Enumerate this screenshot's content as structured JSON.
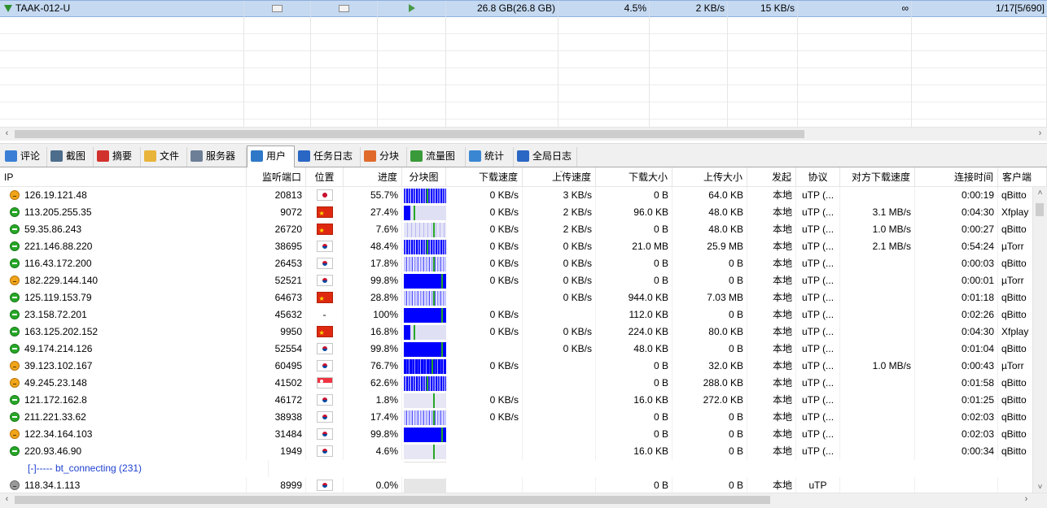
{
  "task": {
    "name": "TAAK-012-U",
    "size": "26.8 GB(26.8 GB)",
    "progress": "4.5%",
    "download_speed": "2 KB/s",
    "upload_speed": "15 KB/s",
    "remaining": "∞",
    "peers": "1/17[5/690]"
  },
  "tabs": [
    {
      "label": "评论",
      "icon": "comment-icon",
      "color": "#3a7fd5"
    },
    {
      "label": "截图",
      "icon": "screenshot-icon",
      "color": "#4d6d8c"
    },
    {
      "label": "摘要",
      "icon": "summary-icon",
      "color": "#d2322d"
    },
    {
      "label": "文件",
      "icon": "folder-icon",
      "color": "#e8b43a"
    },
    {
      "label": "服务器",
      "icon": "server-icon",
      "color": "#6d7f96"
    },
    {
      "label": "用户",
      "icon": "users-icon",
      "color": "#2f78c8"
    },
    {
      "label": "任务日志",
      "icon": "info-icon",
      "color": "#2a66c4"
    },
    {
      "label": "分块",
      "icon": "pie-icon",
      "color": "#e06a2a"
    },
    {
      "label": "流量图",
      "icon": "chart-icon",
      "color": "#3a9a3a"
    },
    {
      "label": "统计",
      "icon": "stats-icon",
      "color": "#3a86d2"
    },
    {
      "label": "全局日志",
      "icon": "info-icon",
      "color": "#2a66c4"
    }
  ],
  "active_tab": 5,
  "columns": [
    "IP",
    "监听端口",
    "位置",
    "进度",
    "分块图",
    "下载速度",
    "上传速度",
    "下载大小",
    "上传大小",
    "发起",
    "协议",
    "对方下载速度",
    "连接时间",
    "客户端"
  ],
  "peers": [
    {
      "status": "orange",
      "ip": "126.19.121.48",
      "port": "20813",
      "flag": "jp",
      "progress": 0.557,
      "progress_text": "55.7%",
      "blocks": "mid",
      "dl": "0 KB/s",
      "ul": "3 KB/s",
      "dl_size": "0 B",
      "ul_size": "64.0 KB",
      "origin": "本地",
      "protocol": "uTP (...",
      "peer_dl": "",
      "time": "0:00:19",
      "client": "qBitto"
    },
    {
      "status": "green",
      "ip": "113.205.255.35",
      "port": "9072",
      "flag": "cn",
      "progress": 0.274,
      "progress_text": "27.4%",
      "blocks": "low",
      "dl": "0 KB/s",
      "ul": "2 KB/s",
      "dl_size": "96.0 KB",
      "ul_size": "48.0 KB",
      "origin": "本地",
      "protocol": "uTP (...",
      "peer_dl": "3.1 MB/s",
      "time": "0:04:30",
      "client": "Xfplay"
    },
    {
      "status": "green",
      "ip": "59.35.86.243",
      "port": "26720",
      "flag": "cn",
      "progress": 0.076,
      "progress_text": "7.6%",
      "blocks": "sparse",
      "dl": "0 KB/s",
      "ul": "2 KB/s",
      "dl_size": "0 B",
      "ul_size": "48.0 KB",
      "origin": "本地",
      "protocol": "uTP (...",
      "peer_dl": "1.0 MB/s",
      "time": "0:00:27",
      "client": "qBitto"
    },
    {
      "status": "green",
      "ip": "221.146.88.220",
      "port": "38695",
      "flag": "kr",
      "progress": 0.484,
      "progress_text": "48.4%",
      "blocks": "mid",
      "dl": "0 KB/s",
      "ul": "0 KB/s",
      "dl_size": "21.0 MB",
      "ul_size": "25.9 MB",
      "origin": "本地",
      "protocol": "uTP (...",
      "peer_dl": "2.1 MB/s",
      "time": "0:54:24",
      "client": "µTorr"
    },
    {
      "status": "green",
      "ip": "116.43.172.200",
      "port": "26453",
      "flag": "kr",
      "progress": 0.178,
      "progress_text": "17.8%",
      "blocks": "light",
      "dl": "0 KB/s",
      "ul": "0 KB/s",
      "dl_size": "0 B",
      "ul_size": "0 B",
      "origin": "本地",
      "protocol": "uTP (...",
      "peer_dl": "",
      "time": "0:00:03",
      "client": "qBitto"
    },
    {
      "status": "orange",
      "ip": "182.229.144.140",
      "port": "52521",
      "flag": "kr",
      "progress": 0.998,
      "progress_text": "99.8%",
      "blocks": "full",
      "dl": "0 KB/s",
      "ul": "0 KB/s",
      "dl_size": "0 B",
      "ul_size": "0 B",
      "origin": "本地",
      "protocol": "uTP (...",
      "peer_dl": "",
      "time": "0:00:01",
      "client": "µTorr"
    },
    {
      "status": "green",
      "ip": "125.119.153.79",
      "port": "64673",
      "flag": "cn",
      "progress": 0.288,
      "progress_text": "28.8%",
      "blocks": "light",
      "dl": "",
      "ul": "0 KB/s",
      "dl_size": "944.0 KB",
      "ul_size": "7.03 MB",
      "origin": "本地",
      "protocol": "uTP (...",
      "peer_dl": "",
      "time": "0:01:18",
      "client": "qBitto"
    },
    {
      "status": "green",
      "ip": "23.158.72.201",
      "port": "45632",
      "flag": "",
      "location_text": "-",
      "progress": 1.0,
      "progress_text": "100%",
      "blocks": "full",
      "dl": "0 KB/s",
      "ul": "",
      "dl_size": "112.0 KB",
      "ul_size": "0 B",
      "origin": "本地",
      "protocol": "uTP (...",
      "peer_dl": "",
      "time": "0:02:26",
      "client": "qBitto"
    },
    {
      "status": "green",
      "ip": "163.125.202.152",
      "port": "9950",
      "flag": "cn",
      "progress": 0.168,
      "progress_text": "16.8%",
      "blocks": "low",
      "dl": "0 KB/s",
      "ul": "0 KB/s",
      "dl_size": "224.0 KB",
      "ul_size": "80.0 KB",
      "origin": "本地",
      "protocol": "uTP (...",
      "peer_dl": "",
      "time": "0:04:30",
      "client": "Xfplay"
    },
    {
      "status": "green",
      "ip": "49.174.214.126",
      "port": "52554",
      "flag": "kr",
      "progress": 0.998,
      "progress_text": "99.8%",
      "blocks": "full",
      "dl": "",
      "ul": "0 KB/s",
      "dl_size": "48.0 KB",
      "ul_size": "0 B",
      "origin": "本地",
      "protocol": "uTP (...",
      "peer_dl": "",
      "time": "0:01:04",
      "client": "qBitto"
    },
    {
      "status": "orange",
      "ip": "39.123.102.167",
      "port": "60495",
      "flag": "kr",
      "progress": 0.767,
      "progress_text": "76.7%",
      "blocks": "heavy",
      "dl": "0 KB/s",
      "ul": "",
      "dl_size": "0 B",
      "ul_size": "32.0 KB",
      "origin": "本地",
      "protocol": "uTP (...",
      "peer_dl": "1.0 MB/s",
      "time": "0:00:43",
      "client": "µTorr"
    },
    {
      "status": "orange",
      "ip": "49.245.23.148",
      "port": "41502",
      "flag": "sg",
      "progress": 0.626,
      "progress_text": "62.6%",
      "blocks": "mid",
      "dl": "",
      "ul": "",
      "dl_size": "0 B",
      "ul_size": "288.0 KB",
      "origin": "本地",
      "protocol": "uTP (...",
      "peer_dl": "",
      "time": "0:01:58",
      "client": "qBitto"
    },
    {
      "status": "green",
      "ip": "121.172.162.8",
      "port": "46172",
      "flag": "kr",
      "progress": 0.018,
      "progress_text": "1.8%",
      "blocks": "pale",
      "dl": "0 KB/s",
      "ul": "",
      "dl_size": "16.0 KB",
      "ul_size": "272.0 KB",
      "origin": "本地",
      "protocol": "uTP (...",
      "peer_dl": "",
      "time": "0:01:25",
      "client": "qBitto"
    },
    {
      "status": "green",
      "ip": "211.221.33.62",
      "port": "38938",
      "flag": "kr",
      "progress": 0.174,
      "progress_text": "17.4%",
      "blocks": "light",
      "dl": "0 KB/s",
      "ul": "",
      "dl_size": "0 B",
      "ul_size": "0 B",
      "origin": "本地",
      "protocol": "uTP (...",
      "peer_dl": "",
      "time": "0:02:03",
      "client": "qBitto"
    },
    {
      "status": "orange",
      "ip": "122.34.164.103",
      "port": "31484",
      "flag": "kr",
      "progress": 0.998,
      "progress_text": "99.8%",
      "blocks": "full",
      "dl": "",
      "ul": "",
      "dl_size": "0 B",
      "ul_size": "0 B",
      "origin": "本地",
      "protocol": "uTP (...",
      "peer_dl": "",
      "time": "0:02:03",
      "client": "qBitto"
    },
    {
      "status": "green",
      "ip": "220.93.46.90",
      "port": "1949",
      "flag": "kr",
      "progress": 0.046,
      "progress_text": "4.6%",
      "blocks": "pale",
      "dl": "",
      "ul": "",
      "dl_size": "16.0 KB",
      "ul_size": "0 B",
      "origin": "本地",
      "protocol": "uTP (...",
      "peer_dl": "",
      "time": "0:00:34",
      "client": "qBitto"
    }
  ],
  "group_label": "[-]----- bt_connecting (231)",
  "connecting_peer": {
    "status": "gray",
    "ip": "118.34.1.113",
    "port": "8999",
    "flag": "kr",
    "progress_text": "0.0%",
    "dl_size": "0 B",
    "ul_size": "0 B",
    "origin": "本地",
    "protocol": "uTP"
  },
  "colors": {
    "selection": "#c5d9f1",
    "block_blue": "#0000ff",
    "group_text": "#1c3fd0"
  }
}
